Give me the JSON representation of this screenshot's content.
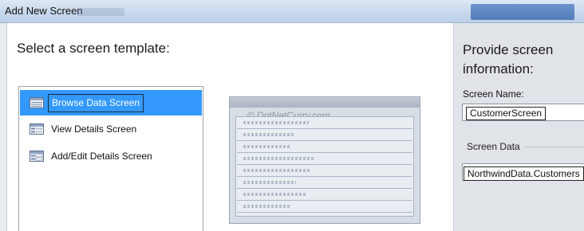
{
  "window": {
    "title": "Add New Screen"
  },
  "left_panel": {
    "heading": "Select a screen template:",
    "templates": [
      {
        "label": "Browse Data Screen",
        "selected": true,
        "icon": "grid-list-icon"
      },
      {
        "label": "View Details Screen",
        "selected": false,
        "icon": "details-icon"
      },
      {
        "label": "Add/Edit Details Screen",
        "selected": false,
        "icon": "edit-details-icon"
      }
    ],
    "preview_watermark": "© DotNetCurry.com"
  },
  "right_panel": {
    "heading": "Provide screen information:",
    "screen_name_label": "Screen Name:",
    "screen_name_value": "CustomerScreen",
    "screen_data_label": "Screen Data",
    "screen_data_value": "NorthwindData.Customers"
  },
  "colors": {
    "selection": "#3399ff",
    "titlebar": "#c7d8ec"
  }
}
